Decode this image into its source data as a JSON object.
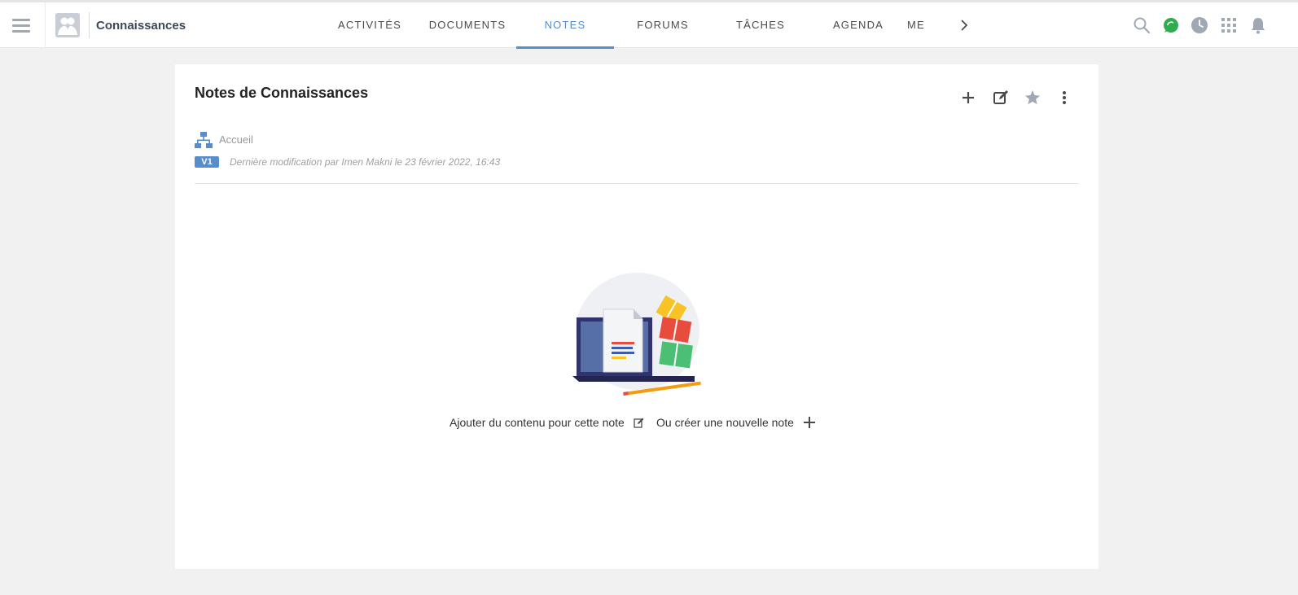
{
  "topbar": {
    "space_name": "Connaissances",
    "tabs": [
      {
        "label": "ACTIVITÉS",
        "active": false
      },
      {
        "label": "DOCUMENTS",
        "active": false
      },
      {
        "label": "NOTES",
        "active": true
      },
      {
        "label": "FORUMS",
        "active": false
      },
      {
        "label": "TÂCHES",
        "active": false
      },
      {
        "label": "AGENDA",
        "active": false
      },
      {
        "label": "ME",
        "active": false
      }
    ],
    "icons": [
      "search-icon",
      "chat-icon",
      "clock-icon",
      "apps-grid-icon",
      "bell-icon"
    ]
  },
  "colors": {
    "accent": "#578dc9",
    "chat_green": "#2eac4f",
    "icon_gray": "#a0a8b4"
  },
  "page": {
    "title": "Notes de Connaissances",
    "breadcrumb": "Accueil",
    "version": "V1",
    "last_modified": "Dernière modification par Imen Makni le 23 février 2022, 16:43",
    "toolbar_icons": [
      "add-icon",
      "edit-icon",
      "star-icon",
      "more-icon"
    ]
  },
  "empty_state": {
    "add_content_text": "Ajouter du contenu pour cette note",
    "or_create_text": "Ou créer une nouvelle note"
  }
}
